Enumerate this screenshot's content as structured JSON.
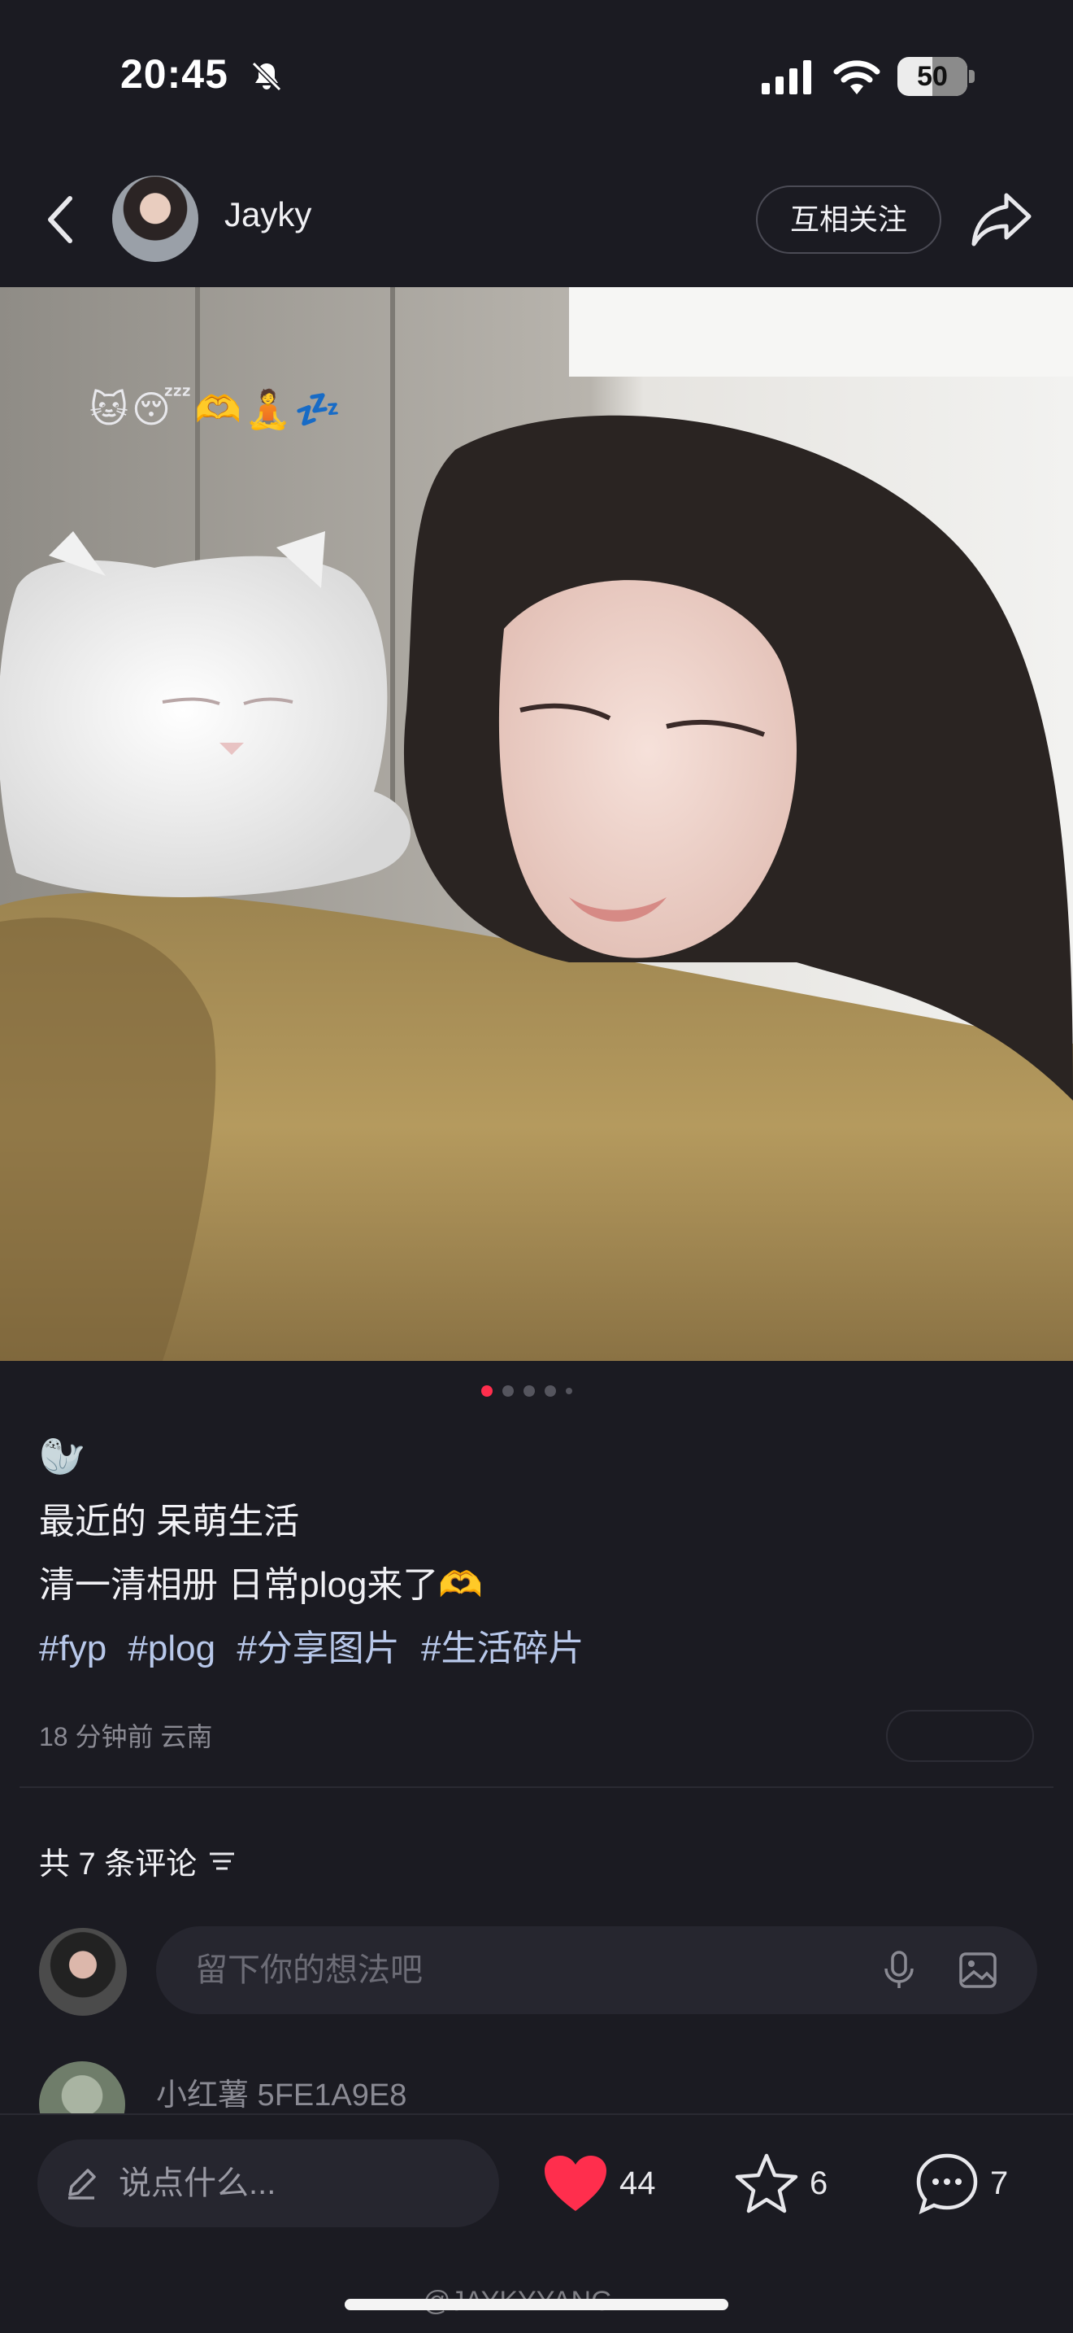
{
  "status_bar": {
    "time": "20:45",
    "battery_percent": "50",
    "battery_level": 0.5,
    "icons": [
      "bell-off-icon",
      "cellular-signal-icon",
      "wifi-icon",
      "battery-icon"
    ]
  },
  "header": {
    "author_name": "Jayky",
    "follow_label": "互相关注",
    "icons": [
      "back-arrow-icon",
      "share-icon"
    ]
  },
  "photo": {
    "overlay_emoji": "🐱😴🫶🧘💤",
    "pagination": {
      "total_dots": 5,
      "active_index": 0
    }
  },
  "caption": {
    "emoji": "🦭",
    "line1": "最近的 呆萌生活",
    "line2": "清一清相册 日常plog来了🫶",
    "tags": [
      "#fyp",
      "#plog",
      "#分享图片",
      "#生活碎片"
    ],
    "meta": "18 分钟前  云南"
  },
  "comments": {
    "header": "共 7 条评论",
    "input_placeholder": "留下你的想法吧",
    "first_comment_author": "小红薯 5FE1A9E8"
  },
  "bottom_bar": {
    "say_placeholder": "说点什么...",
    "likes": "44",
    "stars": "6",
    "comments": "7"
  },
  "colors": {
    "background": "#1b1b22",
    "accent_red": "#ff2e4d",
    "tag_blue": "#b8c8ea"
  },
  "watermark": "@JAYKYYANG"
}
